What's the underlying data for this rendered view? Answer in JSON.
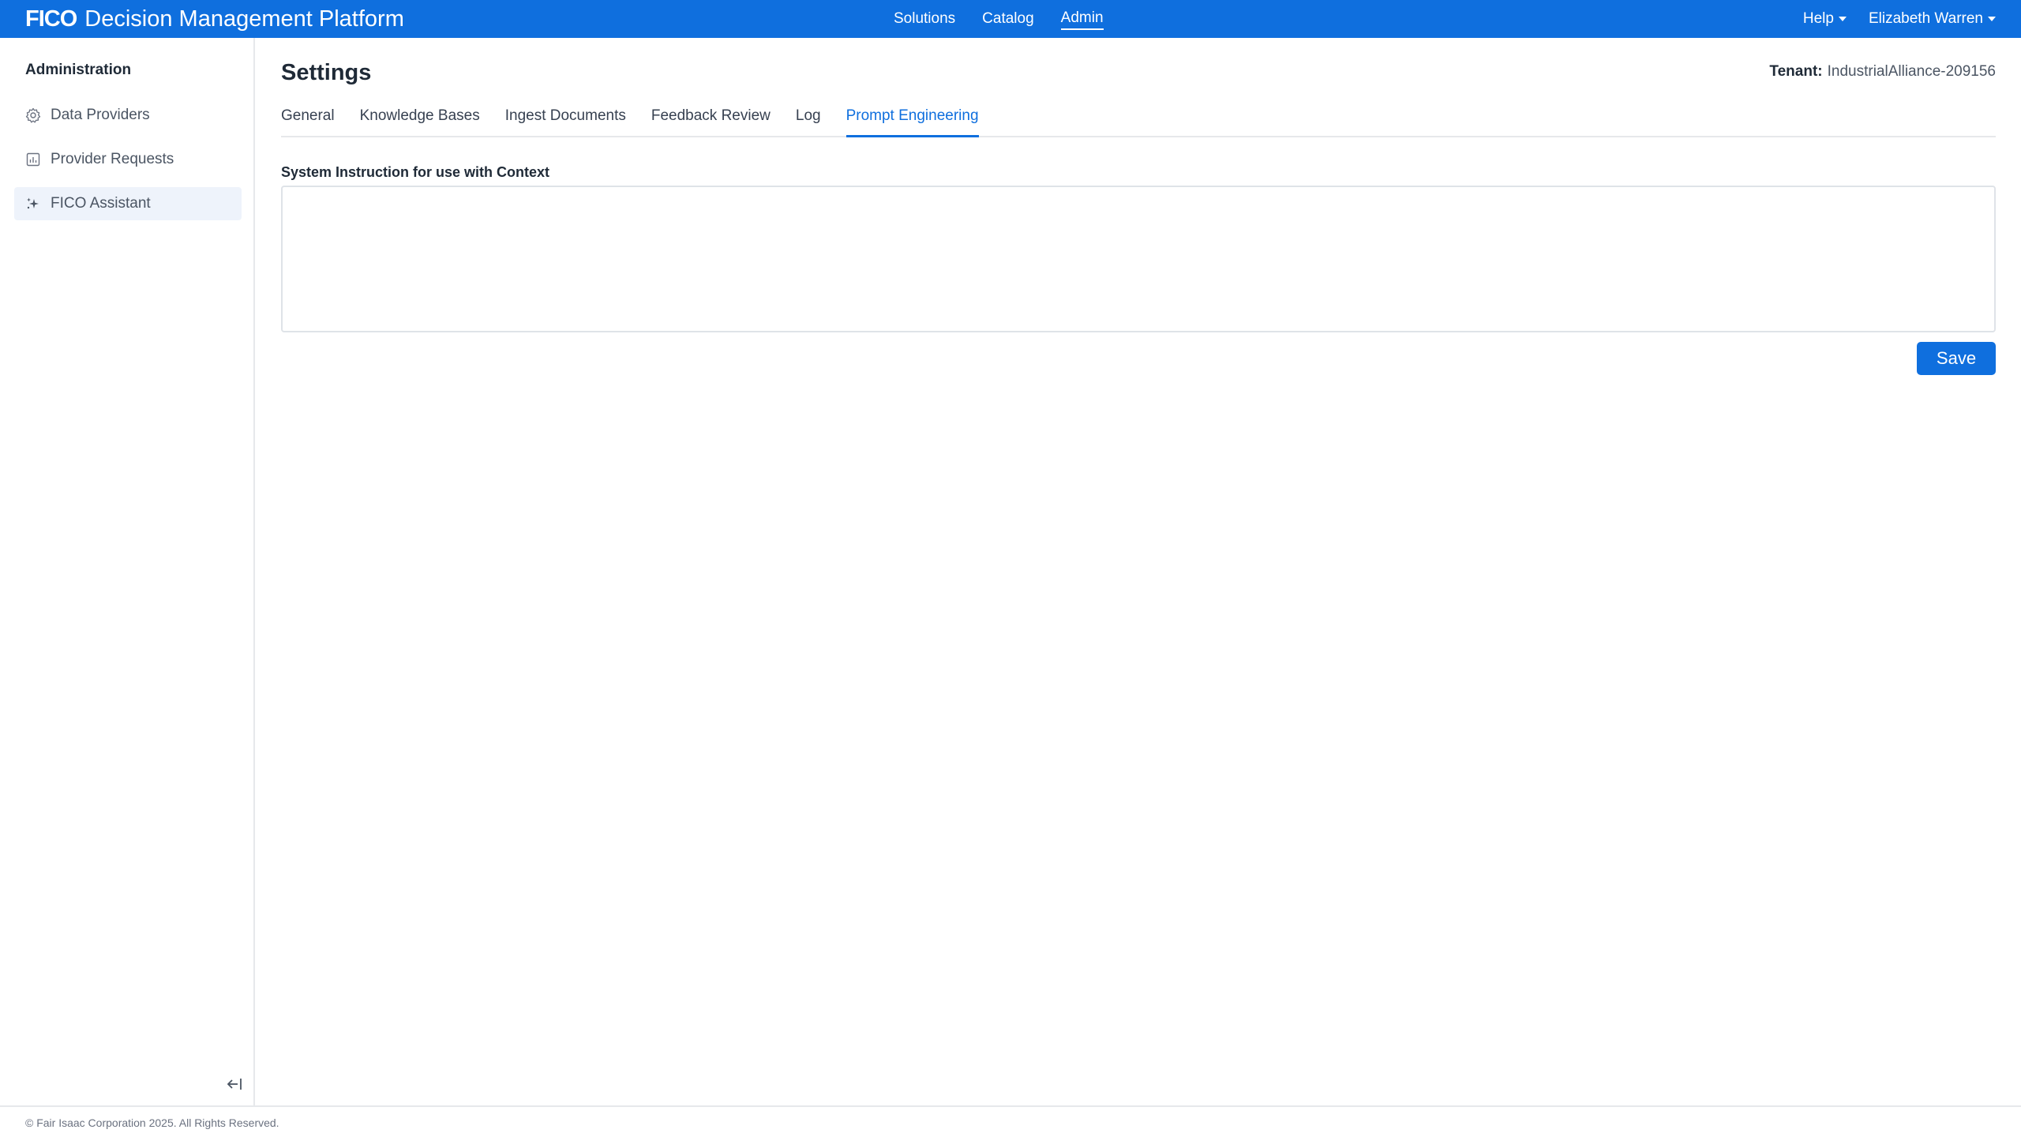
{
  "header": {
    "brand_logo": "FICO",
    "brand_title": "Decision Management Platform",
    "nav": [
      {
        "label": "Solutions"
      },
      {
        "label": "Catalog"
      },
      {
        "label": "Admin"
      }
    ],
    "help_label": "Help",
    "user_label": "Elizabeth Warren"
  },
  "sidebar": {
    "heading": "Administration",
    "items": [
      {
        "label": "Data Providers",
        "icon": "gear-icon"
      },
      {
        "label": "Provider Requests",
        "icon": "report-icon"
      },
      {
        "label": "FICO Assistant",
        "icon": "sparkle-icon"
      }
    ],
    "collapse_icon": "collapse-left-icon"
  },
  "main": {
    "title": "Settings",
    "tenant_label": "Tenant:",
    "tenant_value": "IndustrialAlliance-209156",
    "tabs": [
      {
        "label": "General"
      },
      {
        "label": "Knowledge Bases"
      },
      {
        "label": "Ingest Documents"
      },
      {
        "label": "Feedback Review"
      },
      {
        "label": "Log"
      },
      {
        "label": "Prompt Engineering"
      }
    ],
    "field_label": "System Instruction for use with Context",
    "field_value": "",
    "save_label": "Save"
  },
  "footer": {
    "copyright": "© Fair Isaac Corporation 2025. All Rights Reserved."
  },
  "colors": {
    "brand_blue": "#0f6fde",
    "selected_bg": "#eef3fb"
  }
}
